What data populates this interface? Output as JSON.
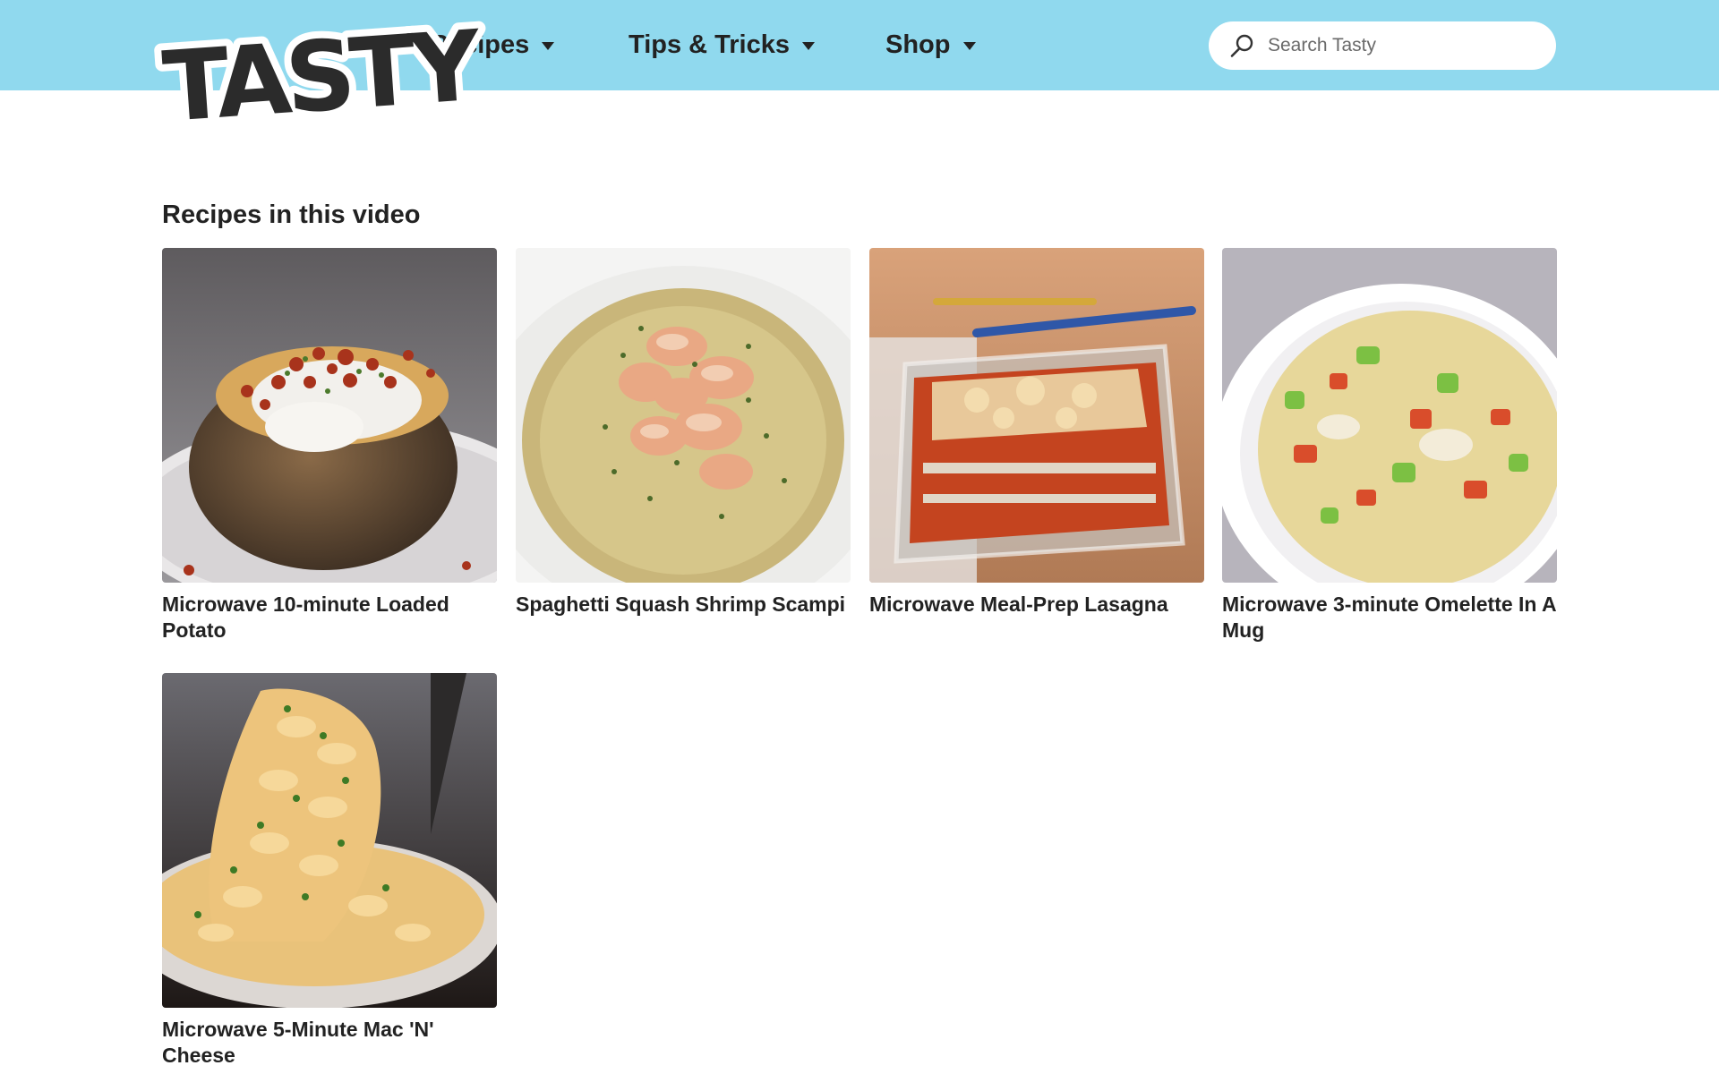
{
  "header": {
    "logo_text": "TASTY",
    "nav": [
      {
        "label": "Recipes"
      },
      {
        "label": "Tips & Tricks"
      },
      {
        "label": "Shop"
      }
    ],
    "search": {
      "placeholder": "Search Tasty",
      "value": ""
    }
  },
  "colors": {
    "nav_background": "#90d9ee",
    "text": "#222222"
  },
  "main": {
    "section_title": "Recipes in this video",
    "recipes": [
      {
        "title": "Microwave 10-minute Loaded Potato",
        "image": "loaded-potato-photo"
      },
      {
        "title": "Spaghetti Squash Shrimp Scampi",
        "image": "shrimp-scampi-photo"
      },
      {
        "title": "Microwave Meal-Prep Lasagna",
        "image": "lasagna-photo"
      },
      {
        "title": "Microwave 3-minute Omelette In A Mug",
        "image": "omelette-mug-photo"
      },
      {
        "title": "Microwave 5-Minute Mac 'N' Cheese",
        "image": "mac-cheese-photo"
      }
    ]
  }
}
